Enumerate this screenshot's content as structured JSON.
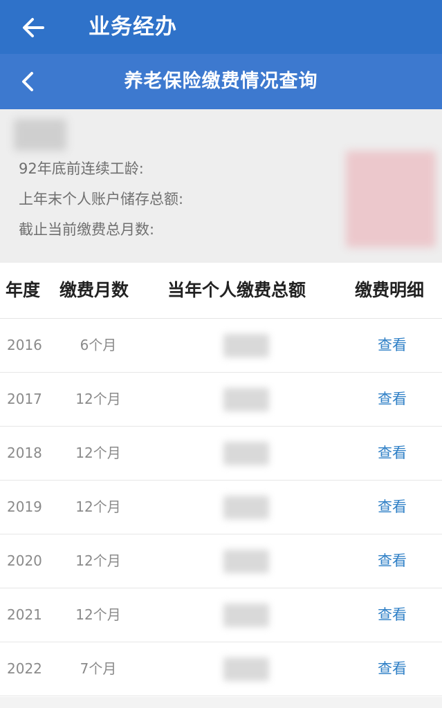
{
  "app_bar": {
    "title": "业务经办",
    "back_icon": "arrow-left-icon"
  },
  "sub_bar": {
    "title": "养老保险缴费情况查询",
    "back_icon": "chevron-left-icon"
  },
  "info": {
    "labels": {
      "work_years": "92年底前连续工龄:",
      "account_total": "上年末个人账户储存总额:",
      "months_total": "截止当前缴费总月数:"
    }
  },
  "table": {
    "headers": {
      "year": "年度",
      "months": "缴费月数",
      "amount": "当年个人缴费总额",
      "detail": "缴费明细"
    },
    "rows": [
      {
        "year": "2016",
        "months": "6个月",
        "detail": "查看"
      },
      {
        "year": "2017",
        "months": "12个月",
        "detail": "查看"
      },
      {
        "year": "2018",
        "months": "12个月",
        "detail": "查看"
      },
      {
        "year": "2019",
        "months": "12个月",
        "detail": "查看"
      },
      {
        "year": "2020",
        "months": "12个月",
        "detail": "查看"
      },
      {
        "year": "2021",
        "months": "12个月",
        "detail": "查看"
      },
      {
        "year": "2022",
        "months": "7个月",
        "detail": "查看"
      }
    ]
  },
  "colors": {
    "app_bar": "#2f72c9",
    "sub_bar": "#3d79cf",
    "link": "#2e7fc6"
  }
}
